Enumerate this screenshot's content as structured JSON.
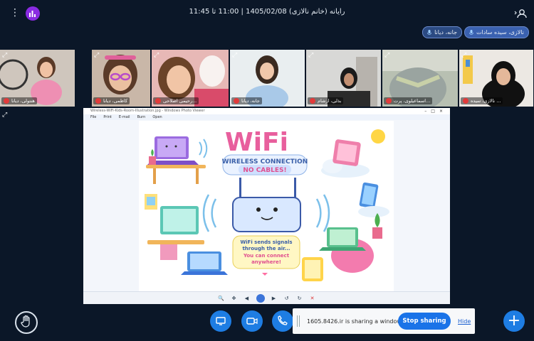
{
  "header": {
    "title": "رایانه (خانم نالازی) 1405/02/08 | 11:00 تا 11:45"
  },
  "badges": [
    {
      "label": "نالازی، سیده سادات",
      "active": true
    },
    {
      "label": "جانه، دیانا",
      "active": false
    }
  ],
  "tiles": [
    {
      "name": "نالازی، سیده ...",
      "speaking": true
    },
    {
      "name": "اسماعیلوی، پرت...",
      "speaking": false
    },
    {
      "name": "بذلی، ارشام",
      "speaking": false
    },
    {
      "name": "جانه، دیانا",
      "speaking": true
    },
    {
      "name": "رحیمی اصلاحی...",
      "speaking": false
    },
    {
      "name": "کاظمی، دیانا",
      "speaking": false
    },
    {
      "name": "هنتولی، دیانا",
      "speaking": false
    }
  ],
  "share": {
    "window_title": "Wireless-WiFi-Kids-Room-Illustration.jpg - Windows Photo Viewer",
    "menu": [
      "File",
      "Print",
      "E-mail",
      "Burn",
      "Open"
    ],
    "poster": {
      "heading": "WiFi",
      "banner_line1": "WIRELESS CONNECTION",
      "banner_line2": "NO CABLES!",
      "bubble_line1": "WiFi sends signals",
      "bubble_line2": "through the air...",
      "bubble_line3": "You can connect",
      "bubble_line4": "anywhere!"
    }
  },
  "sharing_banner": {
    "text": "1605.8426.ir is sharing a window.",
    "stop_label": "Stop sharing",
    "hide_label": "Hide"
  },
  "colors": {
    "background": "#0b1728",
    "accent": "#1e7de3",
    "badge": "#2b4a82",
    "mute": "#e23b3b"
  }
}
